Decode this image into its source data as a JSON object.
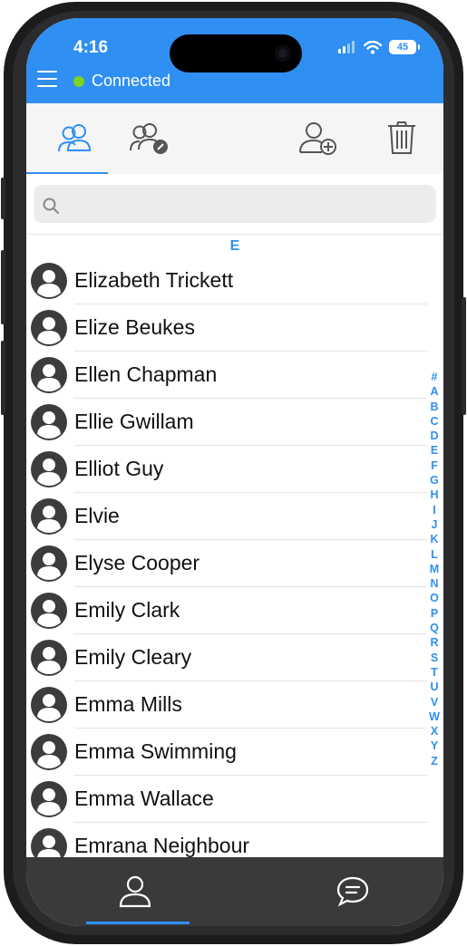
{
  "status_bar": {
    "time": "4:16",
    "battery": "45"
  },
  "header": {
    "connection_status": "Connected"
  },
  "toolbar": {
    "tabs": [
      {
        "name": "contacts-tab",
        "icon": "contacts-icon"
      },
      {
        "name": "contacts-calls-tab",
        "icon": "contacts-phone-icon"
      }
    ],
    "actions": [
      {
        "name": "add-contact-button",
        "icon": "add-user-icon"
      },
      {
        "name": "delete-button",
        "icon": "trash-icon"
      }
    ]
  },
  "search": {
    "placeholder": "",
    "value": ""
  },
  "contacts": {
    "section_letter": "E",
    "items": [
      "Elizabeth Trickett",
      "Elize Beukes",
      "Ellen Chapman",
      "Ellie Gwillam",
      "Elliot Guy",
      "Elvie",
      "Elyse Cooper",
      "Emily Clark",
      "Emily Cleary",
      "Emma Mills",
      "Emma Swimming",
      "Emma Wallace",
      "Emrana Neighbour"
    ]
  },
  "alphabet_index": [
    "#",
    "A",
    "B",
    "C",
    "D",
    "E",
    "F",
    "G",
    "H",
    "I",
    "J",
    "K",
    "L",
    "M",
    "N",
    "O",
    "P",
    "Q",
    "R",
    "S",
    "T",
    "U",
    "V",
    "W",
    "X",
    "Y",
    "Z"
  ],
  "bottom_nav": [
    {
      "name": "contacts",
      "icon": "person-icon"
    },
    {
      "name": "chats",
      "icon": "chat-bubble-icon"
    }
  ],
  "colors": {
    "accent": "#2f8ff2",
    "connected": "#7ed321",
    "bottom_bar": "#3a3a3c"
  }
}
